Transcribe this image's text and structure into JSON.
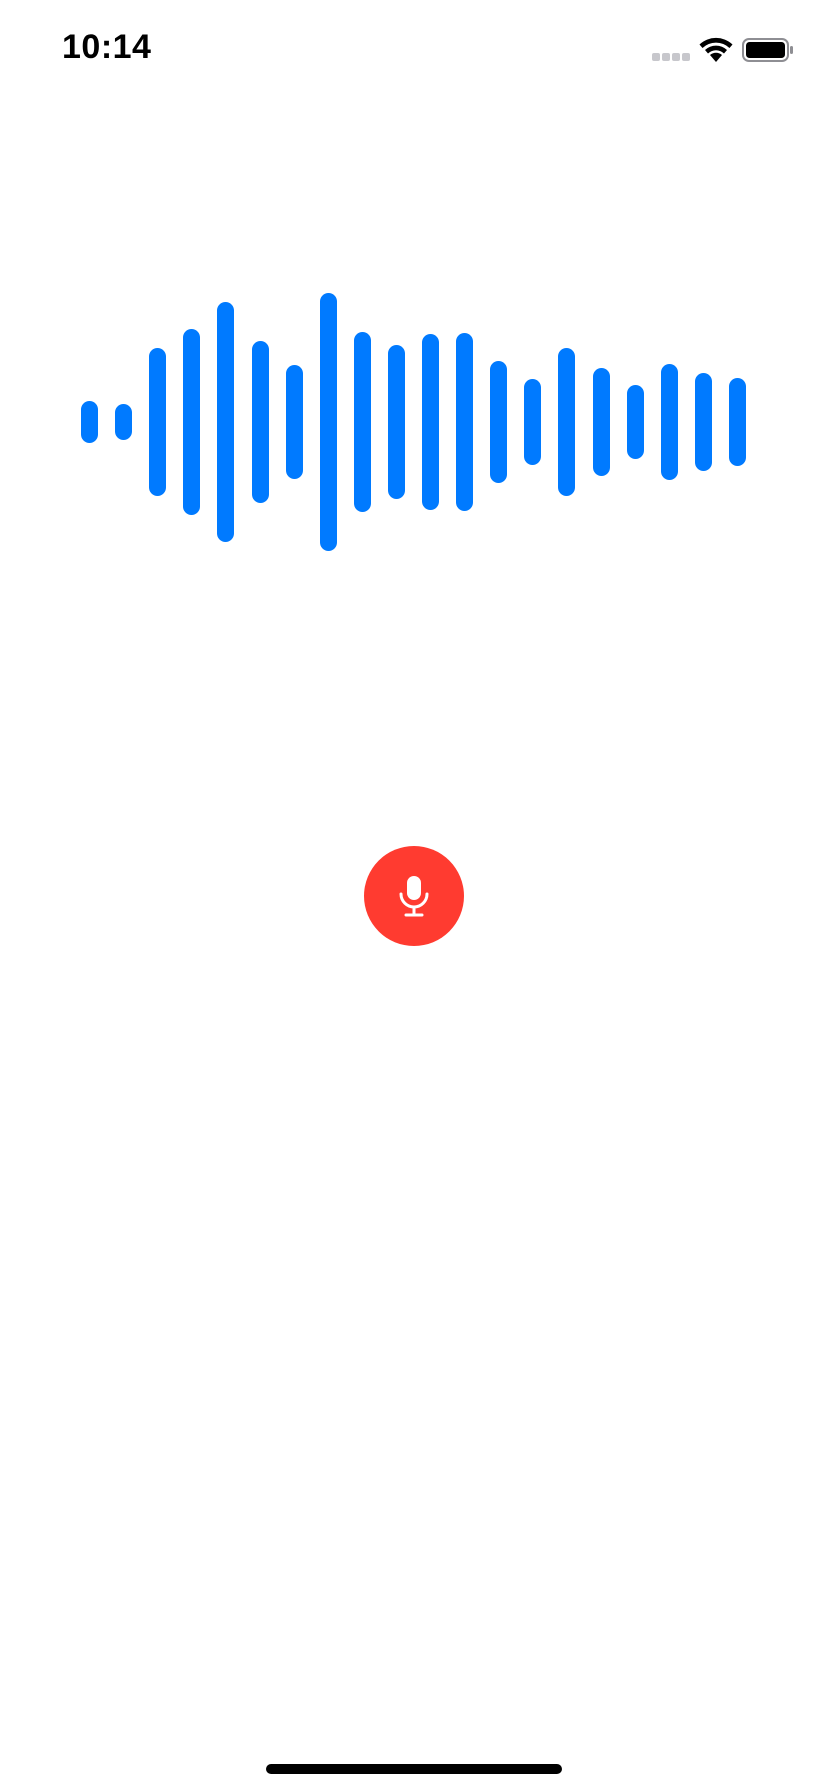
{
  "status_bar": {
    "time": "10:14",
    "icons": [
      "cellular-signal-icon",
      "wifi-icon",
      "battery-icon"
    ]
  },
  "waveform": {
    "color": "#007aff",
    "bar_count": 20,
    "levels": [
      0.16,
      0.14,
      0.57,
      0.72,
      0.93,
      0.63,
      0.44,
      1.0,
      0.7,
      0.6,
      0.68,
      0.69,
      0.47,
      0.33,
      0.57,
      0.42,
      0.29,
      0.45,
      0.38,
      0.34
    ]
  },
  "record_button": {
    "icon": "microphone-icon",
    "background_color": "#ff3b30",
    "icon_color": "#ffffff"
  },
  "colors": {
    "status_text": "#000000",
    "status_inactive": "#c7c7cc",
    "home_indicator": "#000000",
    "background": "#ffffff"
  }
}
